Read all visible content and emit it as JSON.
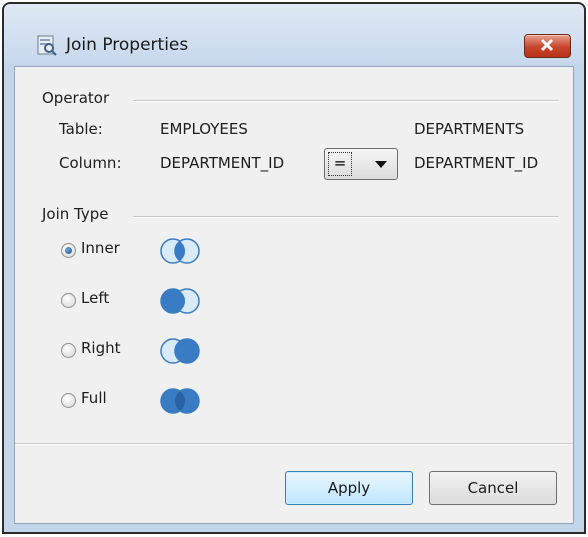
{
  "window": {
    "title": "Join Properties",
    "title_icon": "database-query-icon",
    "close_icon": "close-x-icon"
  },
  "operator": {
    "section_label": "Operator",
    "table_label": "Table:",
    "left_table": "EMPLOYEES",
    "right_table": "DEPARTMENTS",
    "column_label": "Column:",
    "left_column": "DEPARTMENT_ID",
    "operator_value": "=",
    "right_column": "DEPARTMENT_ID"
  },
  "join_type": {
    "section_label": "Join Type",
    "selected": "Inner",
    "options": [
      {
        "label": "Inner",
        "icon": "venn-inner-icon",
        "checked": true
      },
      {
        "label": "Left",
        "icon": "venn-left-icon",
        "checked": false
      },
      {
        "label": "Right",
        "icon": "venn-right-icon",
        "checked": false
      },
      {
        "label": "Full",
        "icon": "venn-full-icon",
        "checked": false
      }
    ]
  },
  "buttons": {
    "apply": "Apply",
    "cancel": "Cancel"
  },
  "colors": {
    "venn_highlight": "#3a7cc4",
    "venn_light": "#cfe4f7",
    "close_red": "#c7452c",
    "apply_border": "#3c7fb1"
  }
}
